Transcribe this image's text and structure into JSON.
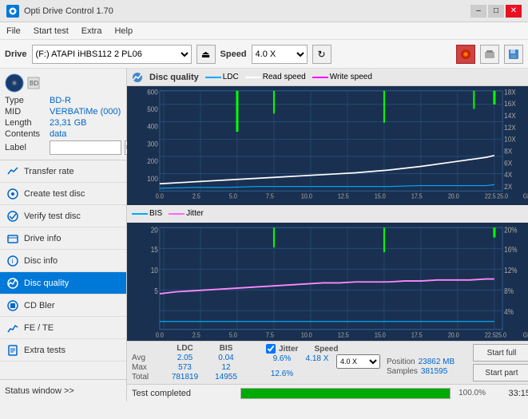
{
  "titleBar": {
    "title": "Opti Drive Control 1.70",
    "minimize": "–",
    "maximize": "□",
    "close": "✕"
  },
  "menu": {
    "items": [
      "File",
      "Start test",
      "Extra",
      "Help"
    ]
  },
  "toolbar": {
    "driveLabel": "Drive",
    "driveValue": "(F:)  ATAPI iHBS112  2 PL06",
    "speedLabel": "Speed",
    "speedValue": "4.0 X"
  },
  "disc": {
    "typeLabel": "Type",
    "typeValue": "BD-R",
    "midLabel": "MID",
    "midValue": "VERBATiMe (000)",
    "lengthLabel": "Length",
    "lengthValue": "23,31 GB",
    "contentsLabel": "Contents",
    "contentsValue": "data",
    "labelLabel": "Label",
    "labelValue": ""
  },
  "nav": {
    "items": [
      {
        "id": "transfer-rate",
        "label": "Transfer rate",
        "icon": "📈"
      },
      {
        "id": "create-test-disc",
        "label": "Create test disc",
        "icon": "💿"
      },
      {
        "id": "verify-test-disc",
        "label": "Verify test disc",
        "icon": "✔"
      },
      {
        "id": "drive-info",
        "label": "Drive info",
        "icon": "ℹ"
      },
      {
        "id": "disc-info",
        "label": "Disc info",
        "icon": "📋"
      },
      {
        "id": "disc-quality",
        "label": "Disc quality",
        "icon": "⭐",
        "active": true
      },
      {
        "id": "cd-bler",
        "label": "CD Bler",
        "icon": "🔵"
      },
      {
        "id": "fe-te",
        "label": "FE / TE",
        "icon": "📊"
      },
      {
        "id": "extra-tests",
        "label": "Extra tests",
        "icon": "🔧"
      }
    ]
  },
  "statusWindow": "Status window >>",
  "chart": {
    "title": "Disc quality",
    "legend": {
      "ldc": "LDC",
      "readSpeed": "Read speed",
      "writeSpeed": "Write speed",
      "bis": "BIS",
      "jitter": "Jitter"
    },
    "upperYAxisLeft": [
      "600",
      "500",
      "400",
      "300",
      "200",
      "100"
    ],
    "upperYAxisRight": [
      "18X",
      "16X",
      "14X",
      "12X",
      "10X",
      "8X",
      "6X",
      "4X",
      "2X"
    ],
    "upperXAxis": [
      "0.0",
      "2.5",
      "5.0",
      "7.5",
      "10.0",
      "12.5",
      "15.0",
      "17.5",
      "20.0",
      "22.5",
      "25.0"
    ],
    "lowerYAxisLeft": [
      "20",
      "15",
      "10",
      "5"
    ],
    "lowerYAxisRight": [
      "20%",
      "16%",
      "12%",
      "8%",
      "4%"
    ],
    "lowerXAxis": [
      "0.0",
      "2.5",
      "5.0",
      "7.5",
      "10.0",
      "12.5",
      "15.0",
      "17.5",
      "20.0",
      "22.5",
      "25.0"
    ],
    "gbLabel": "GB"
  },
  "stats": {
    "headers": [
      "",
      "LDC",
      "BIS",
      "",
      "Jitter",
      "Speed",
      ""
    ],
    "rows": [
      {
        "label": "Avg",
        "ldc": "2.05",
        "bis": "0.04",
        "jitter": "9.6%",
        "speed": "4.18 X",
        "speedSelect": "4.0 X"
      },
      {
        "label": "Max",
        "ldc": "573",
        "bis": "12",
        "jitter": "12.6%",
        "position": "23862 MB"
      },
      {
        "label": "Total",
        "ldc": "781819",
        "bis": "14955",
        "jitter": "",
        "samples": "381595"
      }
    ],
    "jitterChecked": true,
    "speedValue": "4.18 X",
    "speedSelectValue": "4.0 X",
    "positionLabel": "Position",
    "positionValue": "23862 MB",
    "samplesLabel": "Samples",
    "samplesValue": "381595",
    "buttons": {
      "startFull": "Start full",
      "startPart": "Start part"
    }
  },
  "statusBar": {
    "text": "Test completed",
    "progress": 100,
    "time": "33:15"
  },
  "colors": {
    "ldc": "#00aaff",
    "bis": "#ff66ff",
    "jitter": "#ff66ff",
    "readSpeed": "#ffffff",
    "writeSpeed": "#ff00ff",
    "gridLine": "#2a5a8a",
    "chartBg": "#1a3050",
    "spike": "#00ff00",
    "accent": "#0078d7"
  }
}
